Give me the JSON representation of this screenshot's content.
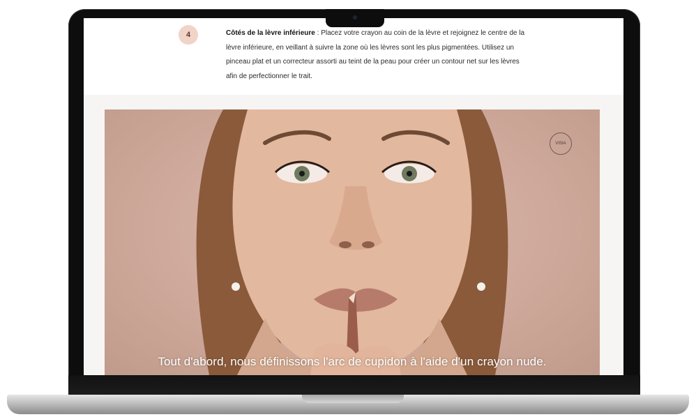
{
  "step": {
    "number": "4",
    "title": "Côtés de la lèvre inférieure",
    "separator": " : ",
    "body": "Placez votre crayon au coin de la lèvre et rejoignez le centre de la lèvre inférieure, en veillant à suivre la zone où les lèvres sont les plus pigmentées. Utilisez un pinceau plat et un correcteur assorti au teint de la peau pour créer un contour net sur les lèvres afin de perfectionner le trait."
  },
  "video": {
    "brand_badge": "VISIA",
    "subtitle": "Tout d'abord, nous définissons l'arc de cupidon à l'aide d'un crayon nude."
  }
}
